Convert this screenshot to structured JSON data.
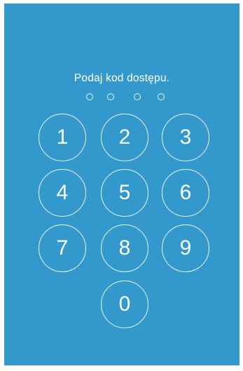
{
  "colors": {
    "background": "#3399cc",
    "foreground": "#ffffff"
  },
  "passcode": {
    "prompt": "Podaj kod dostępu.",
    "dots_total": 4,
    "dots_filled": 0
  },
  "keypad": {
    "keys": [
      "1",
      "2",
      "3",
      "4",
      "5",
      "6",
      "7",
      "8",
      "9",
      "0"
    ]
  }
}
